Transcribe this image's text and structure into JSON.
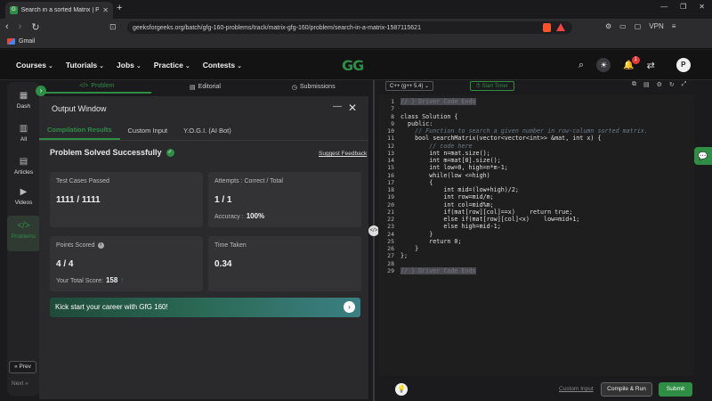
{
  "browser": {
    "tab_title": "Search in a sorted Matrix | Prac",
    "url": "geeksforgeeks.org/batch/gfg-160-problems/track/matrix-gfg-160/problem/search-in-a-matrix-1587115621",
    "bookmark": "Gmail",
    "vpn": "VPN"
  },
  "header": {
    "nav": [
      "Courses",
      "Tutorials",
      "Jobs",
      "Practice",
      "Contests"
    ],
    "logo": "GG",
    "notif_count": "1",
    "avatar": "P"
  },
  "sidebar": {
    "items": [
      "Dash",
      "All",
      "Articles",
      "Videos",
      "Problems"
    ],
    "prev": "« Prev",
    "next": "Next »"
  },
  "problem_tabs": [
    "Problem",
    "Editorial",
    "Submissions"
  ],
  "output": {
    "title": "Output Window",
    "tabs": [
      "Compilation Results",
      "Custom Input",
      "Y.O.G.I. (AI Bot)"
    ],
    "status": "Problem Solved Successfully",
    "feedback": "Suggest Feedback",
    "cards": {
      "test_cases_label": "Test Cases Passed",
      "test_cases_value": "1111 / 1111",
      "attempts_label": "Attempts : Correct / Total",
      "attempts_value": "1 / 1",
      "accuracy_label": "Accuracy :",
      "accuracy_value": "100%",
      "points_label": "Points Scored",
      "points_value": "4 / 4",
      "total_score_label": "Your Total Score:",
      "total_score_value": "158",
      "time_label": "Time Taken",
      "time_value": "0.34"
    },
    "banner": "Kick start your career with GfG 160!"
  },
  "editor": {
    "language": "C++ (g++ 5.4)",
    "timer": "Start Timer",
    "lines": [
      "// } Driver Code Ends",
      "",
      "class Solution {",
      "  public:",
      "    // Function to search a given number in row-column sorted matrix.",
      "    bool searchMatrix(vector<vector<int>> &mat, int x) {",
      "        // code here",
      "        int n=mat.size();",
      "        int m=mat[0].size();",
      "        int low=0, high=n*m-1;",
      "        while(low <=high)",
      "        {",
      "            int mid=(low+high)/2;",
      "            int row=mid/m;",
      "            int col=mid%m;",
      "            if(mat[row][col]==x)    return true;",
      "            else if(mat[row][col]<x)    low=mid+1;",
      "            else high=mid-1;",
      "        }",
      "        return 0;",
      "    }",
      "};",
      "",
      "// } Driver Code Ends"
    ],
    "start_line": 1
  },
  "bottom": {
    "custom_input": "Custom Input",
    "compile": "Compile & Run",
    "submit": "Submit"
  }
}
